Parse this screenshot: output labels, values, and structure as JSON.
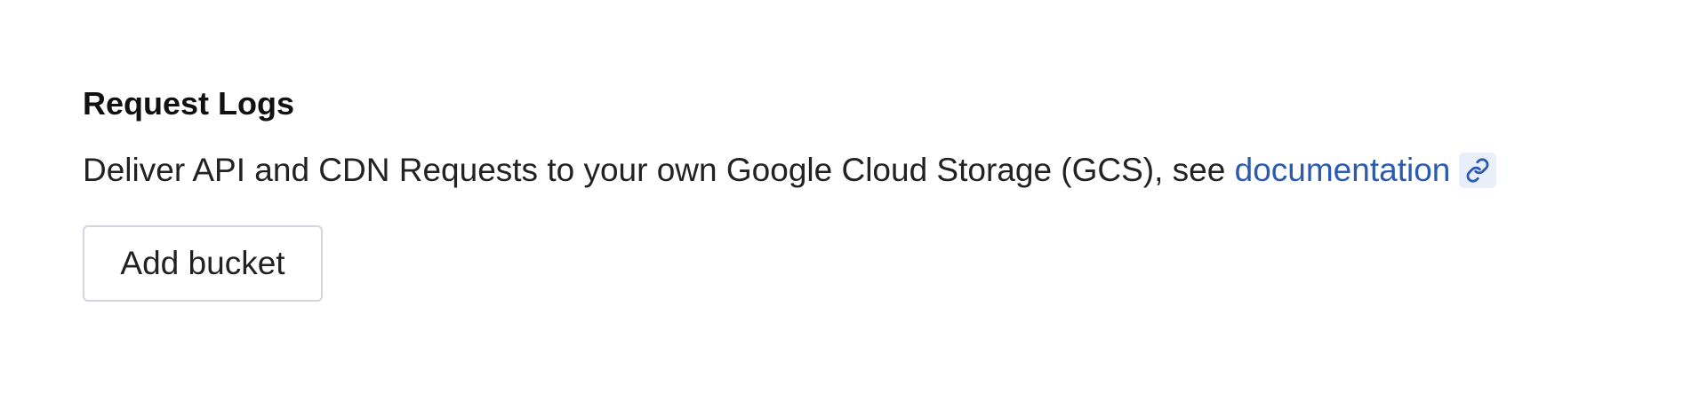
{
  "section": {
    "title": "Request Logs",
    "description_prefix": "Deliver API and CDN Requests to your own Google Cloud Storage (GCS), see ",
    "link_text": "documentation",
    "link_icon": "link-icon",
    "link_color": "#2b5bb1",
    "add_button_label": "Add bucket"
  }
}
